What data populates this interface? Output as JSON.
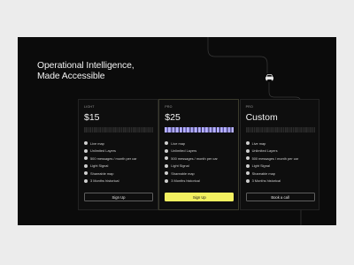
{
  "hero": {
    "line1": "Operational Intelligence,",
    "line2": "Made Accessible"
  },
  "icons": {
    "route": "route-line",
    "car": "car-icon",
    "feature": "check-dot-icon"
  },
  "colors": {
    "background": "#0b0b0b",
    "accent": "#f3f060",
    "pro_meter": "#b7b2ff",
    "text": "#f2f2f2"
  },
  "plans": [
    {
      "tier": "LIGHT",
      "price": "$15",
      "features": [
        "Live map",
        "Unlimited Layers",
        "500 messages / month per car",
        "Light Signal",
        "Shareable map",
        "3 Months historical"
      ],
      "cta": "Sign Up"
    },
    {
      "tier": "PRO",
      "price": "$25",
      "features": [
        "Live map",
        "Unlimited Layers",
        "500 messages / month per car",
        "Light Signal",
        "Shareable map",
        "3 Months historical"
      ],
      "cta": "Sign Up"
    },
    {
      "tier": "PRO",
      "price": "Custom",
      "features": [
        "Live map",
        "Unlimited Layers",
        "500 messages / month per car",
        "Light Signal",
        "Shareable map",
        "3 Months historical"
      ],
      "cta": "Book a call"
    }
  ]
}
